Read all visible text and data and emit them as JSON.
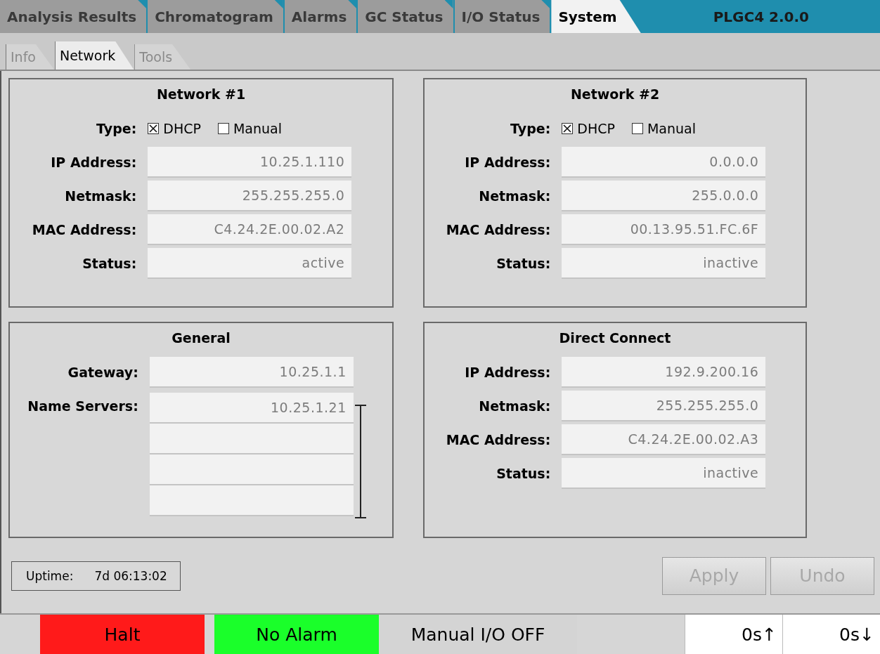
{
  "top_tabs": [
    {
      "label": "Analysis Results",
      "selected": false
    },
    {
      "label": "Chromatogram",
      "selected": false
    },
    {
      "label": "Alarms",
      "selected": false
    },
    {
      "label": "GC Status",
      "selected": false
    },
    {
      "label": "I/O Status",
      "selected": false
    },
    {
      "label": "System",
      "selected": true
    }
  ],
  "version": "PLGC4 2.0.0",
  "sub_tabs": [
    {
      "label": "Info",
      "selected": false
    },
    {
      "label": "Network",
      "selected": true
    },
    {
      "label": "Tools",
      "selected": false
    }
  ],
  "panels": [
    {
      "title": "Network #1",
      "rows": [
        {
          "kind": "type",
          "label": "Type:",
          "options": [
            {
              "label": "DHCP",
              "checked": true
            },
            {
              "label": "Manual",
              "checked": false
            }
          ]
        },
        {
          "kind": "field",
          "label": "IP Address:",
          "value": "10.25.1.110"
        },
        {
          "kind": "field",
          "label": "Netmask:",
          "value": "255.255.255.0"
        },
        {
          "kind": "field",
          "label": "MAC Address:",
          "value": "C4.24.2E.00.02.A2"
        },
        {
          "kind": "field",
          "label": "Status:",
          "value": "active"
        }
      ]
    },
    {
      "title": "Network #2",
      "rows": [
        {
          "kind": "type",
          "label": "Type:",
          "options": [
            {
              "label": "DHCP",
              "checked": true
            },
            {
              "label": "Manual",
              "checked": false
            }
          ]
        },
        {
          "kind": "field",
          "label": "IP Address:",
          "value": "0.0.0.0"
        },
        {
          "kind": "field",
          "label": "Netmask:",
          "value": "255.0.0.0"
        },
        {
          "kind": "field",
          "label": "MAC Address:",
          "value": "00.13.95.51.FC.6F"
        },
        {
          "kind": "field",
          "label": "Status:",
          "value": "inactive"
        }
      ]
    },
    {
      "title": "General",
      "rows": [
        {
          "kind": "field",
          "label": "Gateway:",
          "value": "10.25.1.1"
        },
        {
          "kind": "list",
          "label": "Name Servers:",
          "values": [
            "10.25.1.21"
          ]
        }
      ]
    },
    {
      "title": "Direct Connect",
      "rows": [
        {
          "kind": "field",
          "label": "IP Address:",
          "value": "192.9.200.16"
        },
        {
          "kind": "field",
          "label": "Netmask:",
          "value": "255.255.255.0"
        },
        {
          "kind": "field",
          "label": "MAC Address:",
          "value": "C4.24.2E.00.02.A3"
        },
        {
          "kind": "field",
          "label": "Status:",
          "value": "inactive"
        }
      ]
    }
  ],
  "uptime": {
    "label": "Uptime:",
    "value": "7d 06:13:02"
  },
  "buttons": [
    {
      "label": "Apply",
      "disabled": true
    },
    {
      "label": "Undo",
      "disabled": true
    }
  ],
  "status_bar": {
    "indicators": [
      {
        "label": "Halt",
        "color": "#ff1a1a"
      },
      {
        "label": "No Alarm",
        "color": "#1aff2a"
      },
      {
        "label": "Manual I/O OFF",
        "color": "#d4d4d4"
      }
    ],
    "timers": [
      "0s↑",
      "0s↓"
    ]
  }
}
